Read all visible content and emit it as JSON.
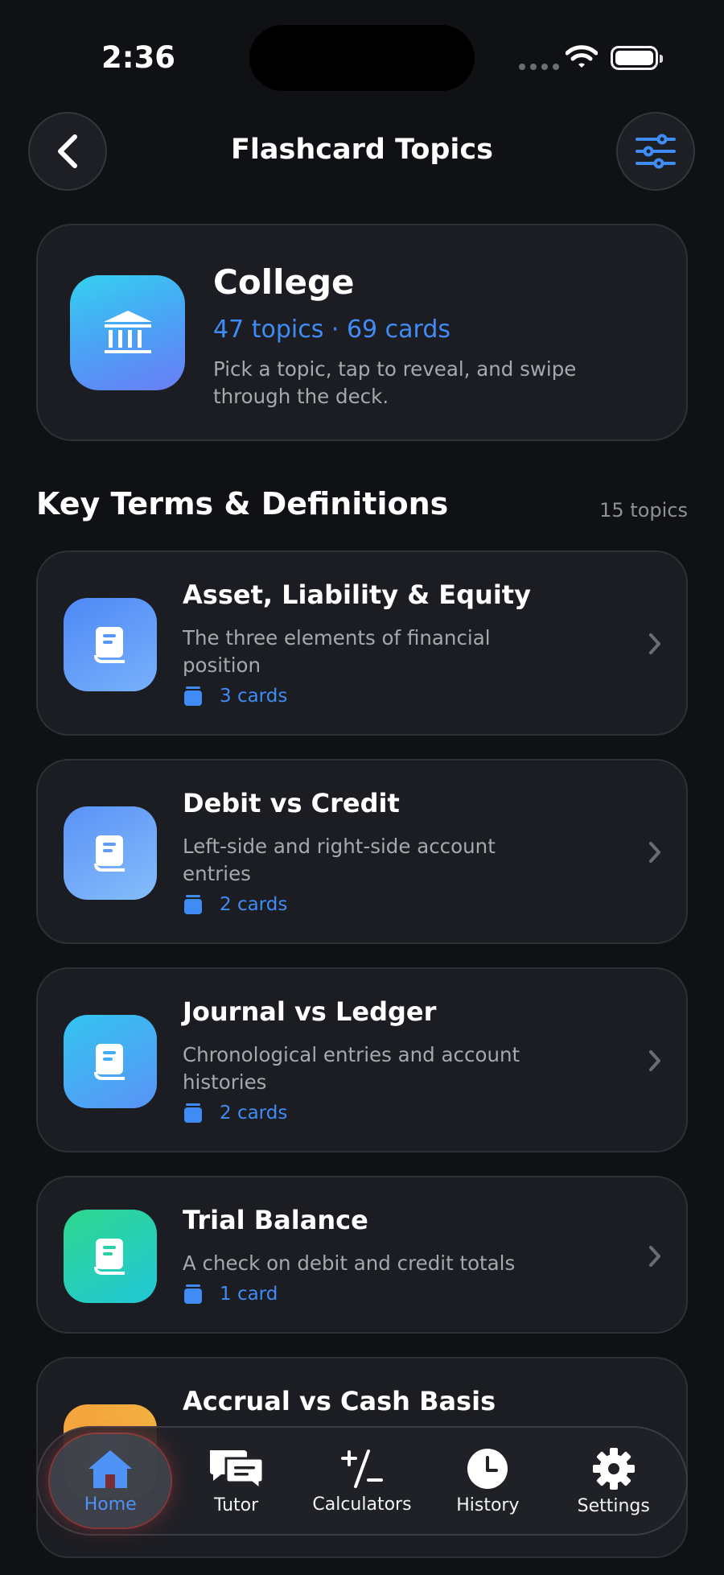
{
  "status_bar": {
    "time": "2:36"
  },
  "header": {
    "title": "Flashcard Topics"
  },
  "hero": {
    "title": "College",
    "stats": "47 topics · 69 cards",
    "description": "Pick a topic, tap to reveal, and swipe through the deck."
  },
  "section": {
    "title": "Key Terms & Definitions",
    "count": "15 topics"
  },
  "topics": [
    {
      "title": "Asset, Liability & Equity",
      "description": "The three elements of financial position",
      "cards": "3 cards",
      "icon": "book-icon"
    },
    {
      "title": "Debit vs Credit",
      "description": "Left-side and right-side account entries",
      "cards": "2 cards",
      "icon": "book-icon"
    },
    {
      "title": "Journal vs Ledger",
      "description": "Chronological entries and account histories",
      "cards": "2 cards",
      "icon": "book-icon"
    },
    {
      "title": "Trial Balance",
      "description": "A check on debit and credit totals",
      "cards": "1 card",
      "icon": "book-icon"
    },
    {
      "title": "Accrual vs Cash Basis",
      "description": "",
      "cards": "",
      "icon": "book-icon"
    }
  ],
  "tabbar": {
    "tabs": [
      {
        "label": "Home",
        "icon": "home-icon",
        "active": true
      },
      {
        "label": "Tutor",
        "icon": "chat-icon",
        "active": false
      },
      {
        "label": "Calculators",
        "icon": "plus-minus-icon",
        "active": false
      },
      {
        "label": "History",
        "icon": "clock-icon",
        "active": false
      },
      {
        "label": "Settings",
        "icon": "gear-icon",
        "active": false
      }
    ]
  },
  "colors": {
    "background": "#101114",
    "card": "#1b1d22",
    "accent": "#3f8cf6",
    "muted_text": "#a6a8ae"
  }
}
